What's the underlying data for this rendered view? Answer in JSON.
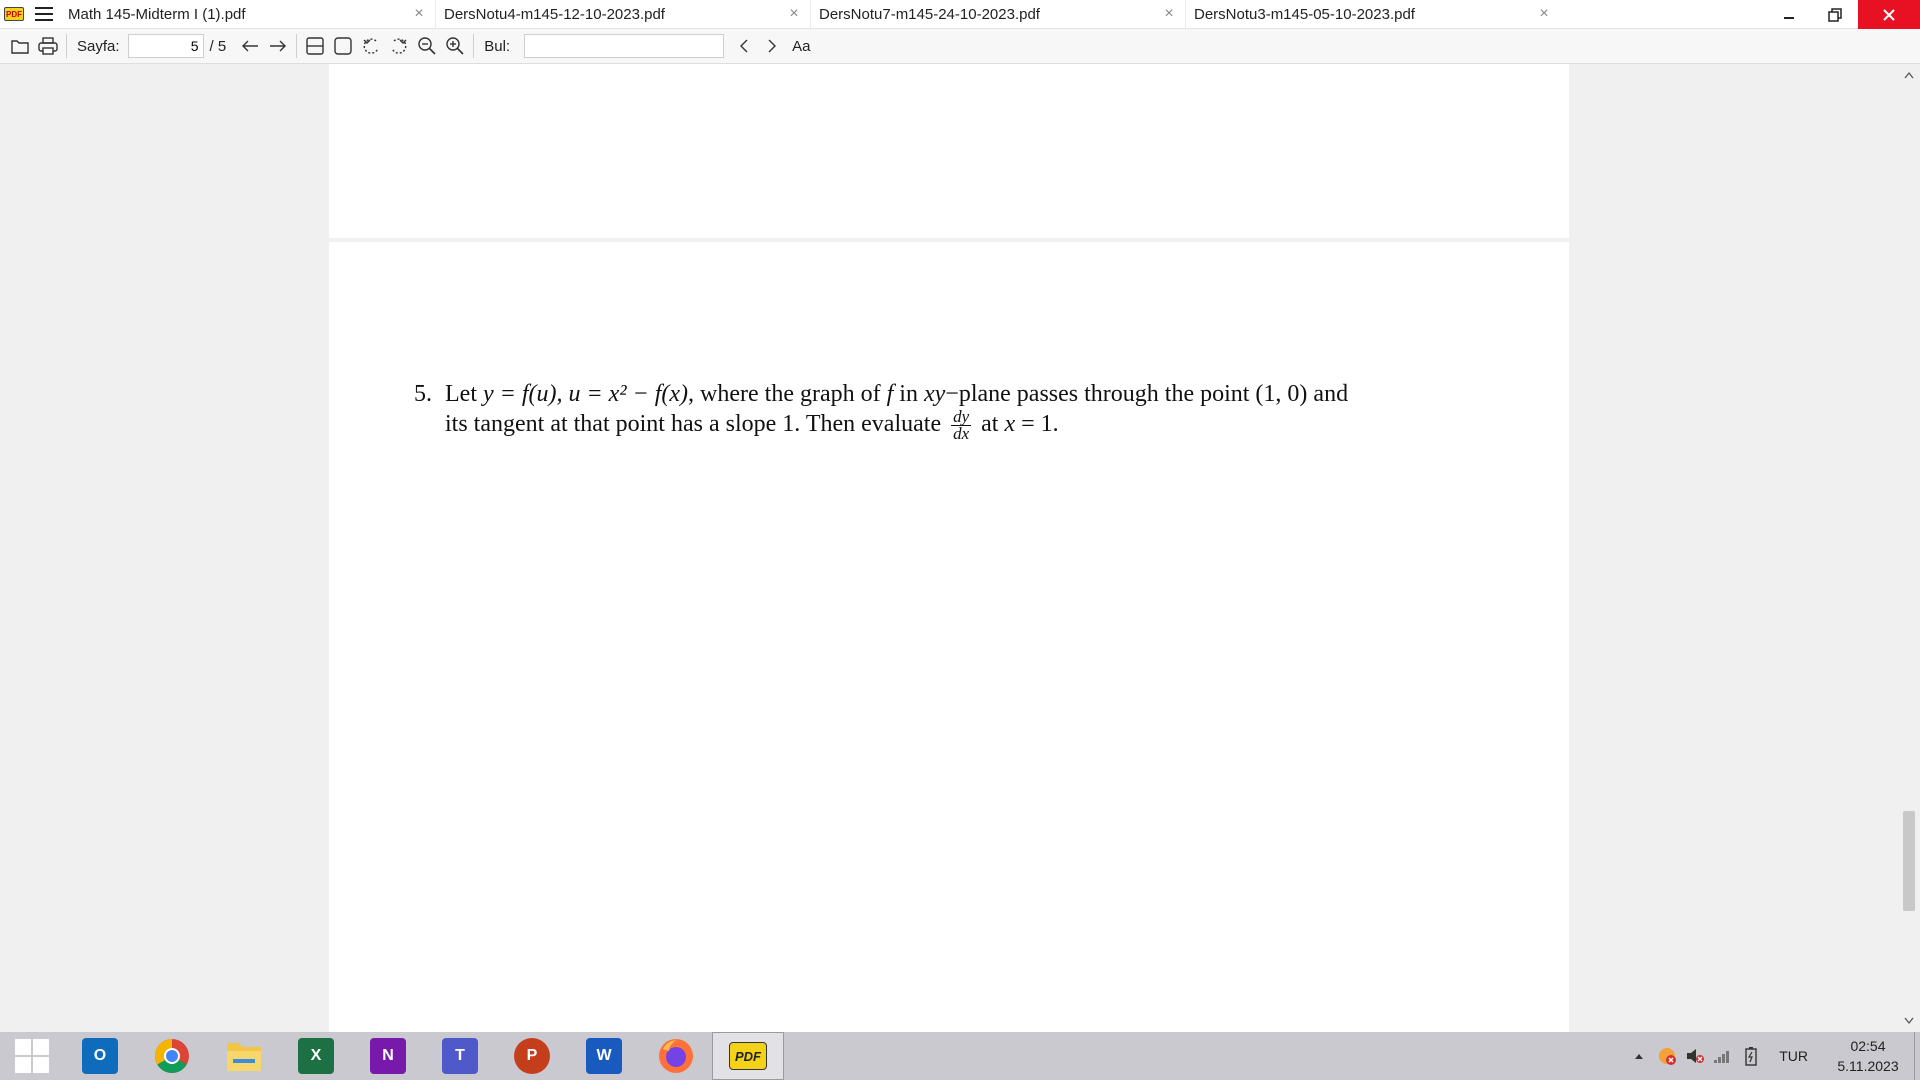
{
  "tabs": [
    {
      "label": "Math 145-Midterm I (1).pdf",
      "active": true
    },
    {
      "label": "DersNotu4-m145-12-10-2023.pdf",
      "active": false
    },
    {
      "label": "DersNotu7-m145-24-10-2023.pdf",
      "active": false
    },
    {
      "label": "DersNotu3-m145-05-10-2023.pdf",
      "active": false
    }
  ],
  "app_logo_text": "PDF",
  "toolbar": {
    "page_label": "Sayfa:",
    "page_current": "5",
    "page_total": "/ 5",
    "find_label": "Bul:",
    "find_value": "",
    "match_case": "Aa"
  },
  "document": {
    "problem_number": "5.",
    "line1_a": "Let ",
    "line1_b": "y = f(u), u = x² − f(x),",
    "line1_c": " where the graph of ",
    "line1_d": "f",
    "line1_e": " in ",
    "line1_f": "xy",
    "line1_g": "−plane passes through the point (1, 0) and",
    "line2_a": "its tangent at that point has a slope 1. Then evaluate",
    "frac_top": "dy",
    "frac_bottom": "dx",
    "line2_b": " at ",
    "line2_c": "x",
    "line2_d": " = 1."
  },
  "taskbar": {
    "apps": [
      {
        "name": "outlook",
        "letter": "O",
        "color": "#0f6cbd"
      },
      {
        "name": "chrome",
        "letter": "",
        "color": "#ffffff"
      },
      {
        "name": "file-explorer",
        "letter": "",
        "color": "#f3c544"
      },
      {
        "name": "excel",
        "letter": "X",
        "color": "#1d7044"
      },
      {
        "name": "onenote",
        "letter": "N",
        "color": "#7719aa"
      },
      {
        "name": "teams",
        "letter": "T",
        "color": "#5059c9"
      },
      {
        "name": "powerpoint",
        "letter": "P",
        "color": "#c43e1c"
      },
      {
        "name": "word",
        "letter": "W",
        "color": "#185abd"
      },
      {
        "name": "firefox",
        "letter": "",
        "color": "#ff7139"
      },
      {
        "name": "pdf-xchange",
        "letter": "PDF",
        "color": "#f5d21a"
      }
    ],
    "language": "TUR",
    "time": "02:54",
    "date": "5.11.2023"
  }
}
